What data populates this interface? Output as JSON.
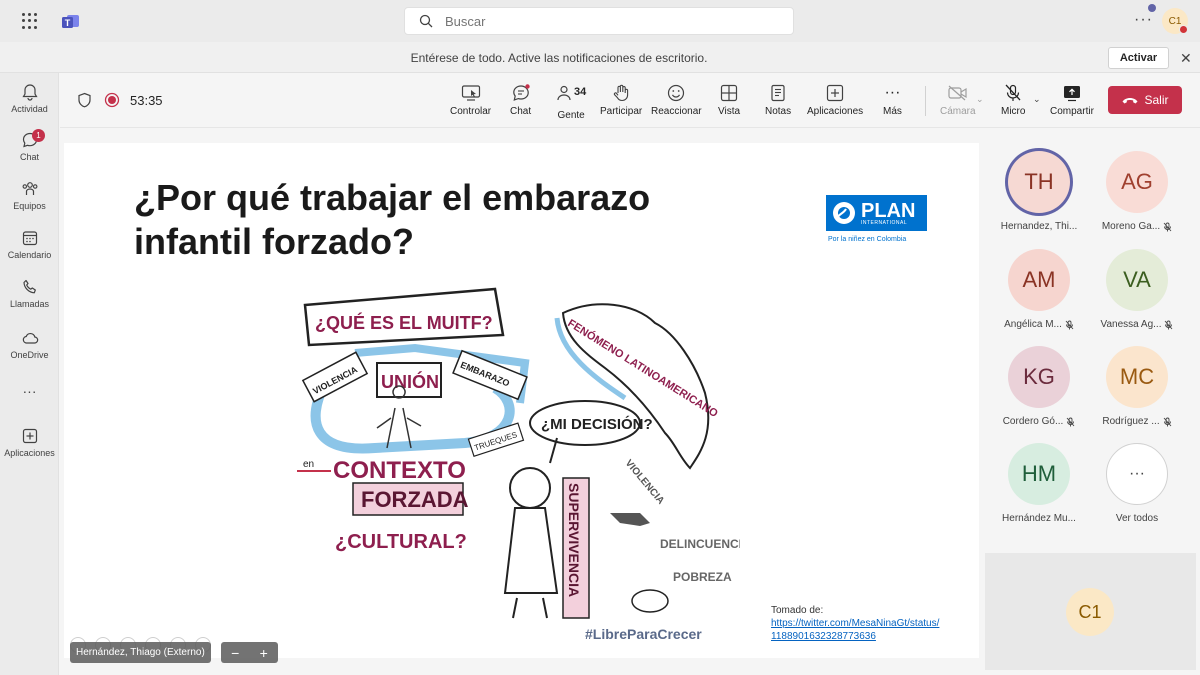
{
  "search": {
    "placeholder": "Buscar"
  },
  "me": {
    "initials": "C1"
  },
  "notification": {
    "text": "Entérese de todo. Active las notificaciones de escritorio.",
    "button": "Activar"
  },
  "rail": [
    {
      "label": "Actividad",
      "icon": "bell-icon"
    },
    {
      "label": "Chat",
      "icon": "chat-icon",
      "badge": "1"
    },
    {
      "label": "Equipos",
      "icon": "teams-icon"
    },
    {
      "label": "Calendario",
      "icon": "calendar-icon"
    },
    {
      "label": "Llamadas",
      "icon": "phone-icon"
    },
    {
      "label": "OneDrive",
      "icon": "cloud-icon"
    },
    {
      "label": "Aplicaciones",
      "icon": "plus-square-icon"
    }
  ],
  "meeting": {
    "timer": "53:35",
    "people_count": "34",
    "tools": {
      "controlar": "Controlar",
      "chat": "Chat",
      "gente": "Gente",
      "participar": "Participar",
      "reaccionar": "Reaccionar",
      "vista": "Vista",
      "notas": "Notas",
      "aplicaciones": "Aplicaciones",
      "mas": "Más",
      "camara": "Cámara",
      "micro": "Micro",
      "compartir": "Compartir"
    },
    "leave": "Salir"
  },
  "slide": {
    "title_line1": "¿Por qué trabajar el embarazo",
    "title_line2": "infantil forzado?",
    "logo_text": "PLAN",
    "logo_sub": "INTERNATIONAL",
    "logo_tagline": "Por la niñez en Colombia",
    "drawing_texts": {
      "q1": "¿QUÉ ES EL MUITF?",
      "violencia": "VIOLENCIA",
      "union": "UNIÓN",
      "embarazo": "EMBARAZO",
      "trueques": "TRUEQUES",
      "en": "en",
      "contexto": "CONTEXTO",
      "forzada": "FORZADA",
      "cultural": "¿CULTURAL?",
      "fenomeno": "FENÓMENO LATINOAMERICANO",
      "decision": "¿MI DECISIÓN?",
      "supervivencia": "SUPERVIVENCIA",
      "violencia2": "VIOLENCIA",
      "delincuencia": "DELINCUENCIA",
      "pobreza": "POBREZA",
      "hashtag": "#LibreParaCrecer"
    },
    "credit_label": "Tomado de:",
    "credit_link_1": "https://twitter.com/MesaNinaGt/status/",
    "credit_link_2": "1188901632328773636"
  },
  "presenter_tag": "Hernández, Thiago (Externo)",
  "participants": [
    {
      "initials": "TH",
      "name": "Hernandez, Thi...",
      "muted": false,
      "bg": "#f6d9d3",
      "fg": "#8a3324",
      "speaking": true
    },
    {
      "initials": "AG",
      "name": "Moreno Ga...",
      "muted": true,
      "bg": "#f9dcd6",
      "fg": "#a0402f"
    },
    {
      "initials": "AM",
      "name": "Angélica M...",
      "muted": true,
      "bg": "#f6d5cf",
      "fg": "#8a3324"
    },
    {
      "initials": "VA",
      "name": "Vanessa Ag...",
      "muted": true,
      "bg": "#e4ecd8",
      "fg": "#3b5e1f"
    },
    {
      "initials": "KG",
      "name": "Cordero Gó...",
      "muted": true,
      "bg": "#ead1d8",
      "fg": "#6b2b3d"
    },
    {
      "initials": "MC",
      "name": "Rodríguez ...",
      "muted": true,
      "bg": "#fbe5cd",
      "fg": "#9a5a11"
    },
    {
      "initials": "HM",
      "name": "Hernández Mu...",
      "muted": false,
      "bg": "#d7ede0",
      "fg": "#1f5e3a"
    }
  ],
  "see_all": "Ver todos",
  "self_tile": {
    "initials": "C1"
  }
}
